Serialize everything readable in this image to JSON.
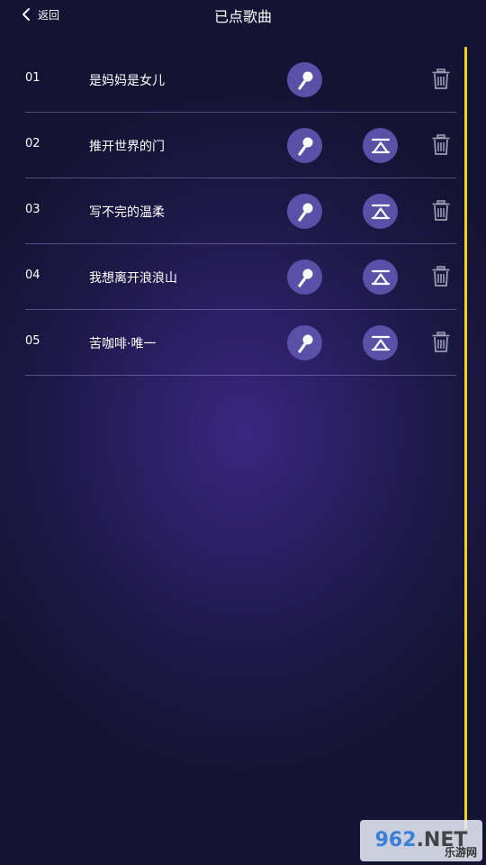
{
  "header": {
    "back_label": "返回",
    "title": "已点歌曲"
  },
  "songs": [
    {
      "num": "01",
      "name": "是妈妈是女儿",
      "has_top_button": false
    },
    {
      "num": "02",
      "name": "推开世界的门",
      "has_top_button": true
    },
    {
      "num": "03",
      "name": "写不完的温柔",
      "has_top_button": true
    },
    {
      "num": "04",
      "name": "我想离开浪浪山",
      "has_top_button": true
    },
    {
      "num": "05",
      "name": "苦咖啡·唯一",
      "has_top_button": true
    }
  ],
  "icons": {
    "back": "chevron-left-icon",
    "sing": "microphone-icon",
    "top": "move-to-top-icon",
    "delete": "trash-icon"
  },
  "colors": {
    "background": "#1c1744",
    "button_fill": "#5b50a8",
    "divider": "#a096dc",
    "scroll_track": "#f0d21c",
    "delete_icon": "#9a9ab0"
  },
  "watermark": {
    "main_962": "962",
    "main_net": ".NET",
    "sub": "乐游网"
  }
}
